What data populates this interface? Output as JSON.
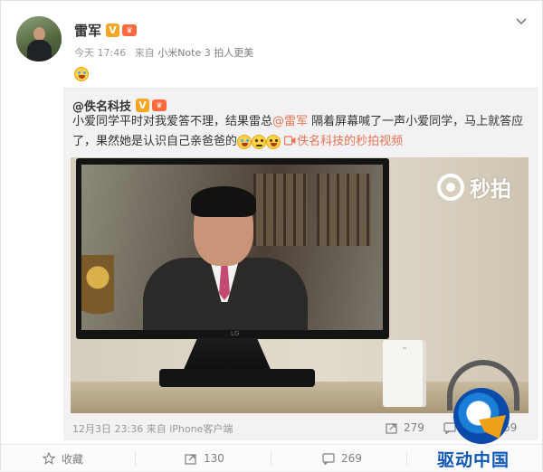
{
  "post": {
    "author": "雷军",
    "verified_badge": "V",
    "member_badge": "♛",
    "time": "今天 17:46",
    "source_prefix": "来自",
    "device": "小米Note 3 拍人更美"
  },
  "repost": {
    "author": "@佚名科技",
    "verified_badge": "V",
    "member_badge": "♛",
    "text_before_mention": "小爱同学平时对我爱答不理，结果雷总",
    "mention": "@雷军",
    "text_after_mention": " 隔着屏幕喊了一声小爱同学，马上就答应了，果然她是认识自己亲爸爸的",
    "video_link": "佚名科技的秒拍视频",
    "video_watermark": "秒拍",
    "monitor_brand": "LG",
    "footer_time": "12月3日 23:36",
    "footer_source": "来自 iPhone客户端",
    "stats": {
      "reposts": "279",
      "comments": "",
      "likes": "69"
    }
  },
  "actions": {
    "favorite": "收藏",
    "repost": "130",
    "comment": "269",
    "like": ""
  },
  "watermark": {
    "text": "驱动中国"
  },
  "colors": {
    "link": "#eb7350",
    "verified": "#f6a623",
    "watermark": "#0f57b5"
  }
}
